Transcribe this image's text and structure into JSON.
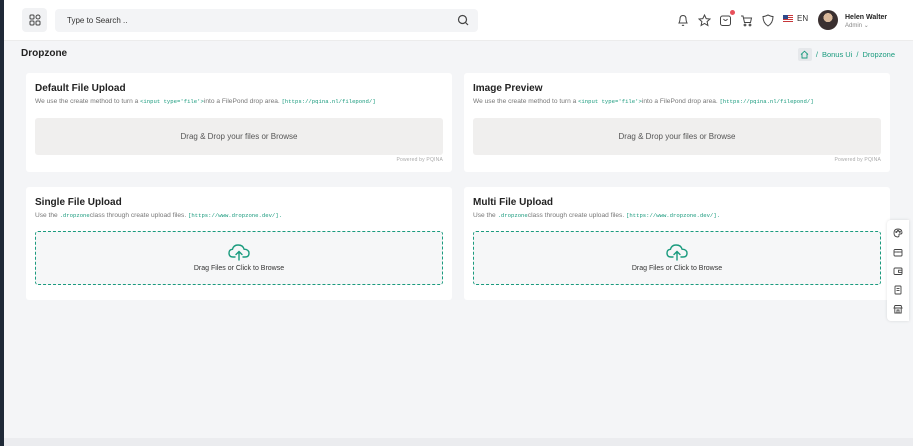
{
  "header": {
    "search_placeholder": "Type to Search ..",
    "lang": "EN",
    "user_name": "Helen Walter",
    "user_role": "Admin",
    "user_role_caret": "⌄",
    "icons": [
      "apps-icon",
      "search-icon",
      "bell-icon",
      "star-icon",
      "cart-bag-icon",
      "shopping-cart-icon",
      "shield-icon",
      "us-flag-icon"
    ]
  },
  "page": {
    "title": "Dropzone",
    "breadcrumb": [
      "Bonus Ui",
      "Dropzone"
    ],
    "separator": "/"
  },
  "cards": {
    "default_upload": {
      "title": "Default File Upload",
      "desc_pre": "We use the create method to turn a ",
      "desc_code": "<input type='file'>",
      "desc_post": "into a FilePond drop area. ",
      "desc_link": "[https://pqina.nl/filepond/]",
      "drop_text": "Drag & Drop your files or Browse",
      "powered": "Powered by PQINA"
    },
    "image_preview": {
      "title": "Image Preview",
      "desc_pre": "We use the create method to turn a ",
      "desc_code": "<input type='file'>",
      "desc_post": "into a FilePond drop area. ",
      "desc_link": "[https://pqina.nl/filepond/]",
      "drop_text": "Drag & Drop your files or Browse",
      "powered": "Powered by PQINA"
    },
    "single_upload": {
      "title": "Single File Upload",
      "desc_pre": "Use the ",
      "desc_code": ".dropzone",
      "desc_post": "class through create upload files. ",
      "desc_link": "[https://www.dropzone.dev/].",
      "drop_text": "Drag Files or Click to Browse"
    },
    "multi_upload": {
      "title": "Multi File Upload",
      "desc_pre": "Use the ",
      "desc_code": ".dropzone",
      "desc_post": "class through create upload files. ",
      "desc_link": "[https://www.dropzone.dev/].",
      "drop_text": "Drag Files or Click to Browse"
    }
  },
  "colors": {
    "accent": "#1a9b7e",
    "sidebar": "#1f2937",
    "background": "#f4f5f7",
    "badge": "#e8505b"
  },
  "right_dock_icons": [
    "palette-icon",
    "box-icon",
    "wallet-icon",
    "document-icon",
    "shop-icon"
  ]
}
